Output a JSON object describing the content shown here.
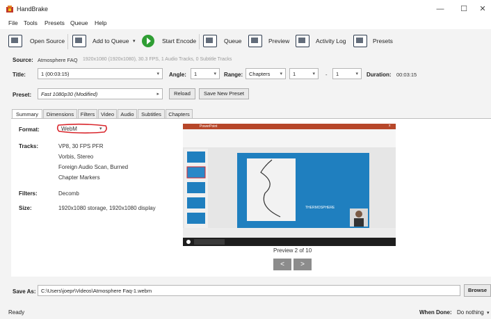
{
  "window": {
    "title": "HandBrake",
    "minimize": "—",
    "maximize": "☐",
    "close": "✕"
  },
  "menu": [
    "File",
    "Tools",
    "Presets",
    "Queue",
    "Help"
  ],
  "toolbar": {
    "open_source": "Open Source",
    "add_to_queue": "Add to Queue",
    "start_encode": "Start Encode",
    "queue": "Queue",
    "preview": "Preview",
    "activity_log": "Activity Log",
    "presets": "Presets",
    "caret": "▾"
  },
  "source": {
    "label": "Source:",
    "name": "Atmosphere FAQ",
    "details": "1920x1080 (1920x1080), 30.3 FPS, 1 Audio Tracks, 0 Subtitle Tracks"
  },
  "title_row": {
    "title_label": "Title:",
    "title_value": "1 (00:03:15)",
    "angle_label": "Angle:",
    "angle_value": "1",
    "range_label": "Range:",
    "range_type": "Chapters",
    "range_start": "1",
    "range_sep": "-",
    "range_end": "1",
    "duration_label": "Duration:",
    "duration_value": "00:03:15",
    "dd": "▾"
  },
  "preset_row": {
    "label": "Preset:",
    "value": "Fast 1080p30 (Modified)",
    "arrow": "▸",
    "reload": "Reload",
    "save_new": "Save New Preset"
  },
  "tabs": [
    "Summary",
    "Dimensions",
    "Filters",
    "Video",
    "Audio",
    "Subtitles",
    "Chapters"
  ],
  "summary": {
    "format_label": "Format:",
    "format_value": "WebM",
    "tracks_label": "Tracks:",
    "tracks": [
      "VP8, 30 FPS PFR",
      "Vorbis, Stereo",
      "Foreign Audio Scan, Burned",
      "Chapter Markers"
    ],
    "filters_label": "Filters:",
    "filters_value": "Decomb",
    "size_label": "Size:",
    "size_value": "1920x1080 storage, 1920x1080 display"
  },
  "preview": {
    "caption": "Preview 2 of 10",
    "prev": "<",
    "next": ">",
    "slide_text": "THERMOSPHERE",
    "ppt_tab": "PowerPoint",
    "ppt_close": "x"
  },
  "save_as": {
    "label": "Save As:",
    "path": "C:\\Users\\joepr\\Videos\\Atmosphere Faq-1.webm",
    "browse": "Browse"
  },
  "status": {
    "text": "Ready",
    "when_done_label": "When Done:",
    "when_done_value": "Do nothing",
    "caret": "▾"
  },
  "colors": {
    "accent_red": "#d9262c",
    "start_green": "#2f9e34",
    "slide_blue": "#1f7fbf"
  }
}
